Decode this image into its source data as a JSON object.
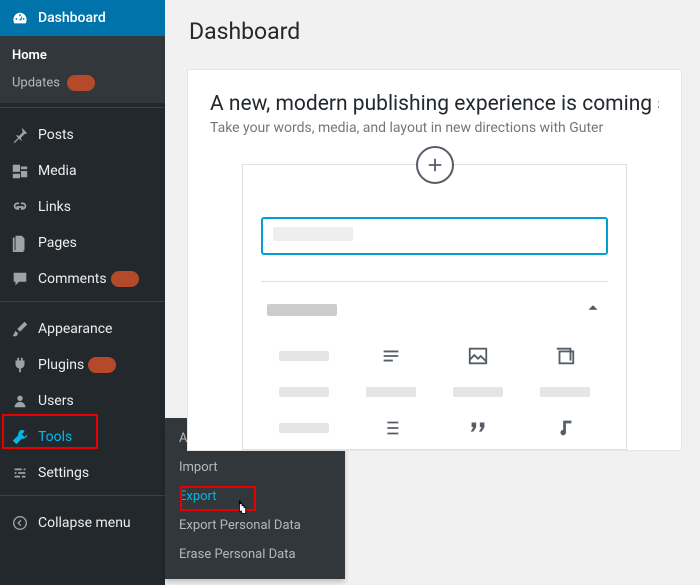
{
  "page_title": "Dashboard",
  "sidebar": {
    "dashboard": "Dashboard",
    "home": "Home",
    "updates": "Updates",
    "posts": "Posts",
    "media": "Media",
    "links": "Links",
    "pages": "Pages",
    "comments": "Comments",
    "appearance": "Appearance",
    "plugins": "Plugins",
    "users": "Users",
    "tools": "Tools",
    "settings": "Settings",
    "collapse": "Collapse menu"
  },
  "tools_submenu": {
    "available": "Available Tools",
    "import": "Import",
    "export": "Export",
    "export_pd": "Export Personal Data",
    "erase_pd": "Erase Personal Data"
  },
  "welcome": {
    "heading": "A new, modern publishing experience is coming s",
    "sub": "Take your words, media, and layout in new directions with Guter"
  }
}
